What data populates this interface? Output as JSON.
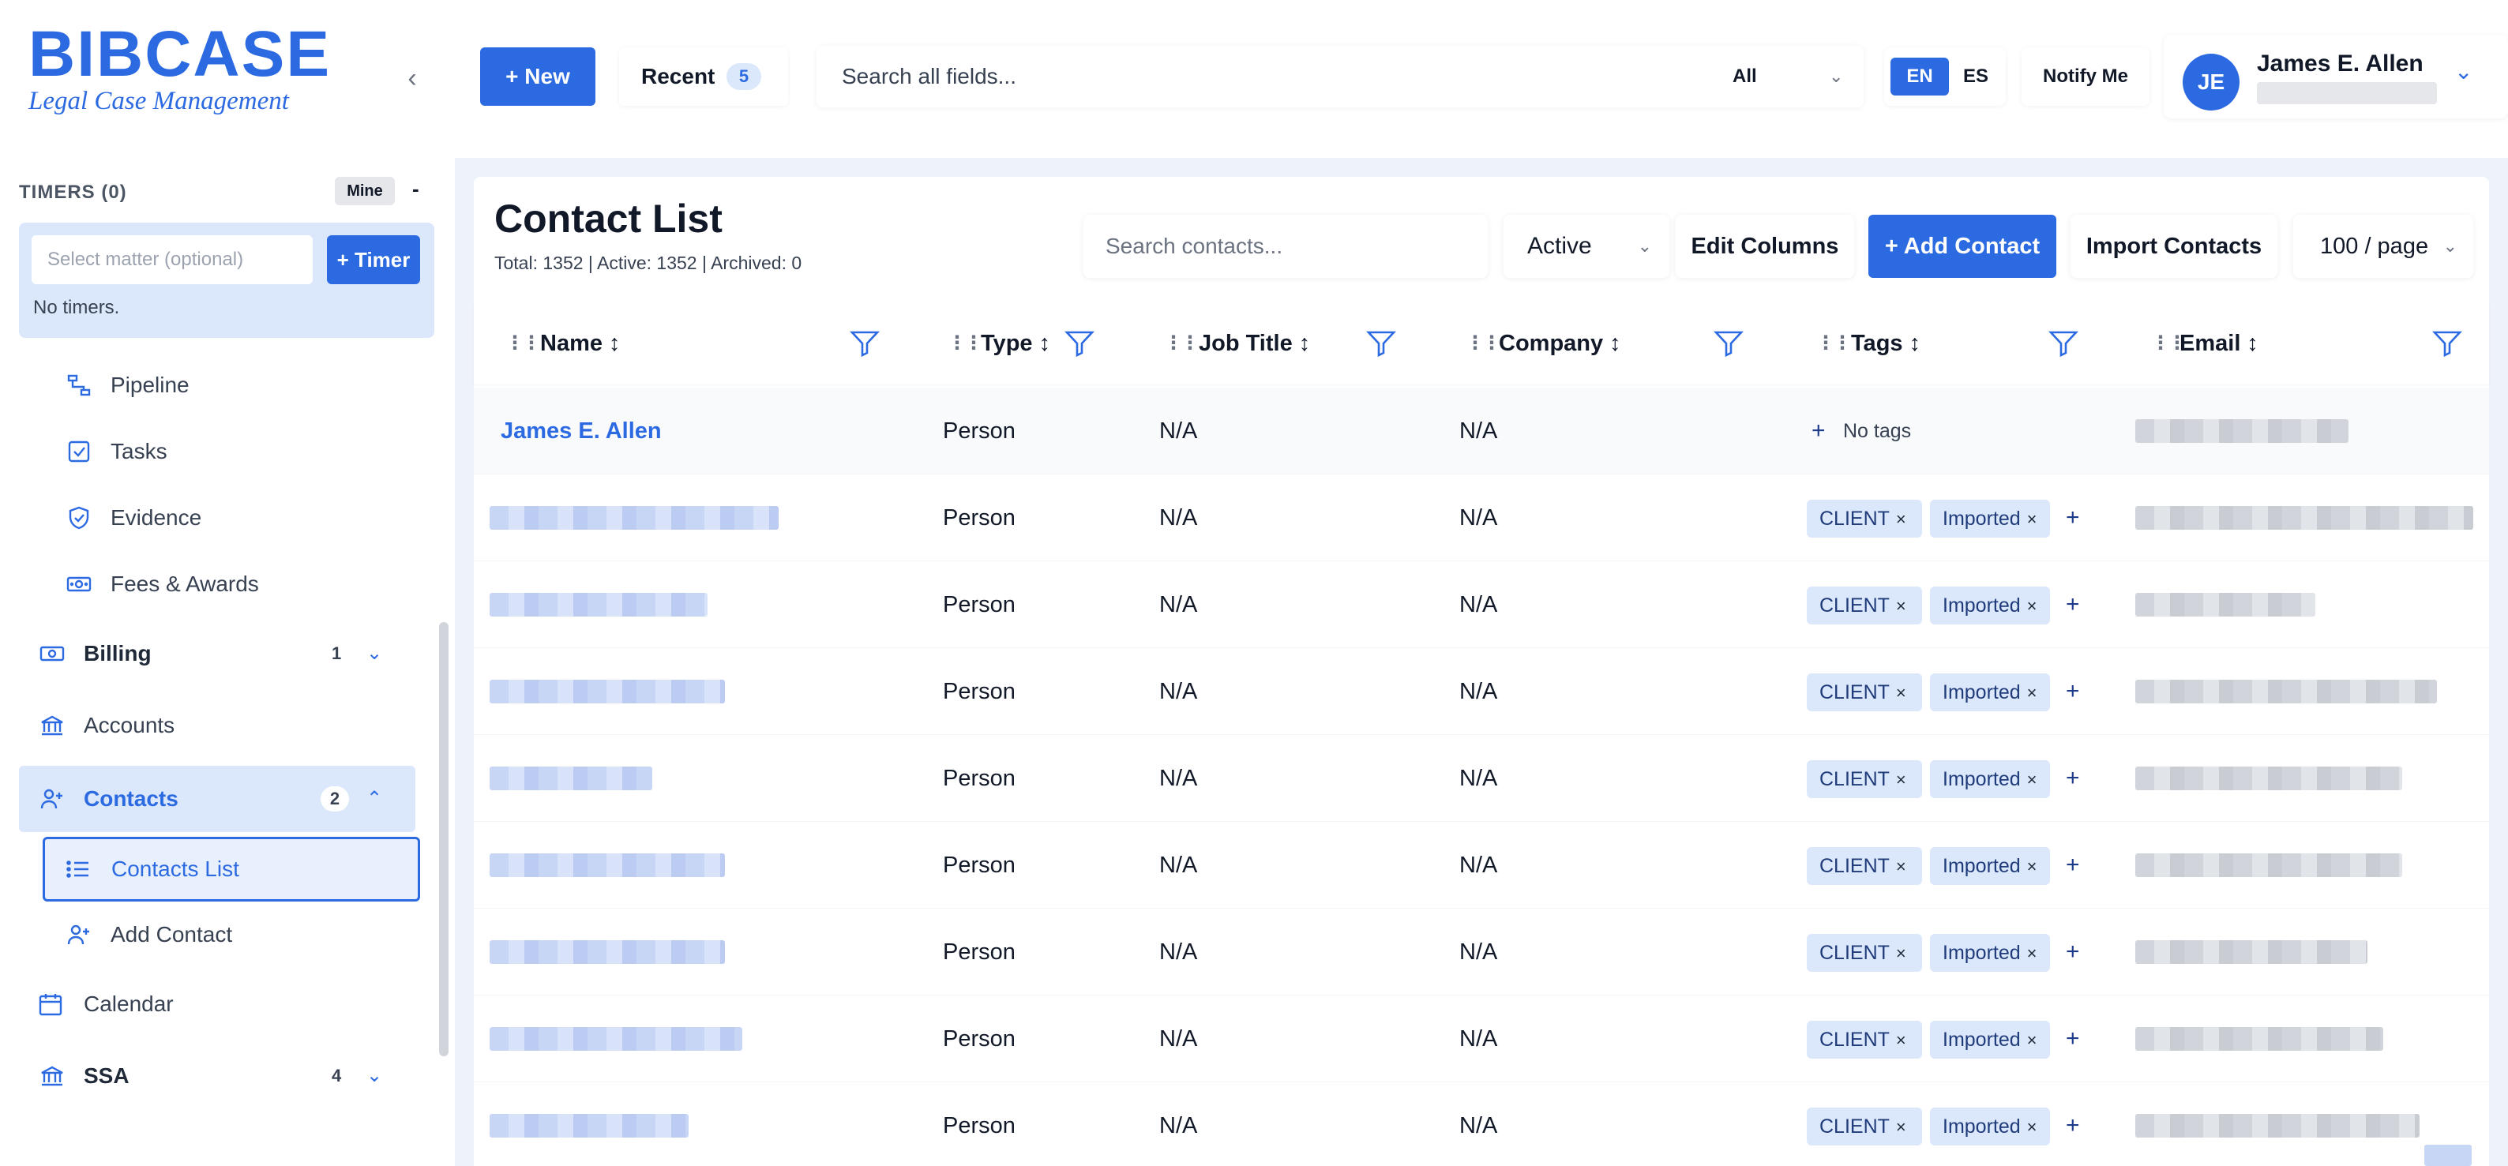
{
  "brand": {
    "logo_text": "BIBCASE",
    "tagline": "Legal Case Management"
  },
  "header": {
    "new_label": "+ New",
    "recent_label": "Recent",
    "recent_count": "5",
    "search_placeholder": "Search all fields...",
    "search_scope": "All",
    "lang_en": "EN",
    "lang_es": "ES",
    "notify_label": "Notify Me",
    "user_initials": "JE",
    "user_name": "James E. Allen"
  },
  "timers": {
    "title": "TIMERS (0)",
    "filter_label": "Mine",
    "collapse_label": "-",
    "matter_placeholder": "Select matter (optional)",
    "timer_button": "+ Timer",
    "empty_text": "No timers."
  },
  "sidebar": {
    "pipeline": "Pipeline",
    "tasks": "Tasks",
    "evidence": "Evidence",
    "fees": "Fees & Awards",
    "billing": {
      "label": "Billing",
      "count": "1"
    },
    "accounts": "Accounts",
    "contacts": {
      "label": "Contacts",
      "count": "2"
    },
    "contacts_list": "Contacts List",
    "add_contact": "Add Contact",
    "calendar": "Calendar",
    "ssa": {
      "label": "SSA",
      "count": "4"
    }
  },
  "contacts": {
    "title": "Contact List",
    "totals": "Total: 1352 | Active: 1352 | Archived: 0",
    "search_placeholder": "Search contacts...",
    "status_filter": "Active",
    "edit_columns": "Edit Columns",
    "add_contact": "+ Add Contact",
    "import_contacts": "Import Contacts",
    "page_size": "100 / page",
    "columns": [
      "Name ↕",
      "Type ↕",
      "Job Title ↕",
      "Company ↕",
      "Tags ↕",
      "Email ↕"
    ],
    "rows": [
      {
        "name": "James E. Allen",
        "type": "Person",
        "job_title": "N/A",
        "company": "N/A",
        "tags": [],
        "no_tags": "No tags"
      },
      {
        "name": "",
        "type": "Person",
        "job_title": "N/A",
        "company": "N/A",
        "tags": [
          "CLIENT",
          "Imported"
        ]
      },
      {
        "name": "",
        "type": "Person",
        "job_title": "N/A",
        "company": "N/A",
        "tags": [
          "CLIENT",
          "Imported"
        ]
      },
      {
        "name": "",
        "type": "Person",
        "job_title": "N/A",
        "company": "N/A",
        "tags": [
          "CLIENT",
          "Imported"
        ]
      },
      {
        "name": "",
        "type": "Person",
        "job_title": "N/A",
        "company": "N/A",
        "tags": [
          "CLIENT",
          "Imported"
        ]
      },
      {
        "name": "",
        "type": "Person",
        "job_title": "N/A",
        "company": "N/A",
        "tags": [
          "CLIENT",
          "Imported"
        ]
      },
      {
        "name": "",
        "type": "Person",
        "job_title": "N/A",
        "company": "N/A",
        "tags": [
          "CLIENT",
          "Imported"
        ]
      },
      {
        "name": "",
        "type": "Person",
        "job_title": "N/A",
        "company": "N/A",
        "tags": [
          "CLIENT",
          "Imported"
        ]
      },
      {
        "name": "",
        "type": "Person",
        "job_title": "N/A",
        "company": "N/A",
        "tags": [
          "CLIENT",
          "Imported"
        ]
      }
    ]
  },
  "colors": {
    "accent": "#2c6ae1",
    "accent_soft": "#dbe7fb",
    "main_bg": "#eef2f9"
  },
  "icons": {
    "pipeline": "pipeline-icon",
    "tasks": "checkbox-icon",
    "evidence": "shield-icon",
    "fees": "money-icon",
    "billing": "money-icon",
    "accounts": "bank-icon",
    "contacts": "user-plus-icon",
    "contacts_list": "list-icon",
    "add_contact": "user-plus-icon",
    "calendar": "calendar-icon",
    "ssa": "bank-icon",
    "filter": "filter-icon",
    "grip": "drag-handle-icon"
  }
}
